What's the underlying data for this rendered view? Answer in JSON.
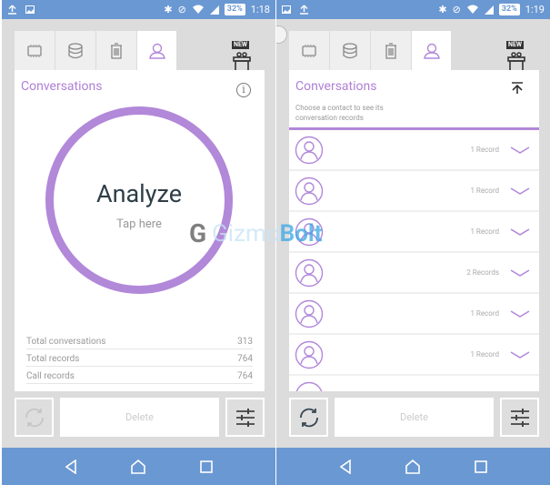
{
  "screens": [
    {
      "status": {
        "time": "1:18",
        "battery": "32%"
      },
      "tabs": [
        {
          "name": "cpu",
          "icon": "cpu-icon"
        },
        {
          "name": "storage",
          "icon": "database-icon"
        },
        {
          "name": "trash",
          "icon": "trash-icon"
        },
        {
          "name": "contacts",
          "icon": "person-icon",
          "active": true
        }
      ],
      "gift_badge": "NEW",
      "card": {
        "title": "Conversations",
        "analyze_label": "Analyze",
        "tap_label": "Tap here",
        "stats": [
          {
            "label": "Total conversations",
            "value": "313"
          },
          {
            "label": "Total records",
            "value": "764"
          },
          {
            "label": "Call records",
            "value": "764"
          }
        ]
      },
      "buttons": {
        "delete": "Delete"
      }
    },
    {
      "status": {
        "time": "1:19",
        "battery": "32%"
      },
      "gift_badge": "NEW",
      "card": {
        "title": "Conversations",
        "subtitle": "Choose a contact to see its conversation records",
        "contacts": [
          {
            "records": "1 Record"
          },
          {
            "records": "1 Record"
          },
          {
            "records": "1 Record"
          },
          {
            "records": "2 Records"
          },
          {
            "records": "1 Record"
          },
          {
            "records": "1 Record"
          }
        ]
      },
      "buttons": {
        "delete": "Delete"
      }
    }
  ],
  "watermark": {
    "part1": "Gizmo",
    "part2": "Bolt"
  },
  "colors": {
    "accent": "#b288d9",
    "statusbar": "#6a98d2",
    "background": "#dcdcdc"
  }
}
